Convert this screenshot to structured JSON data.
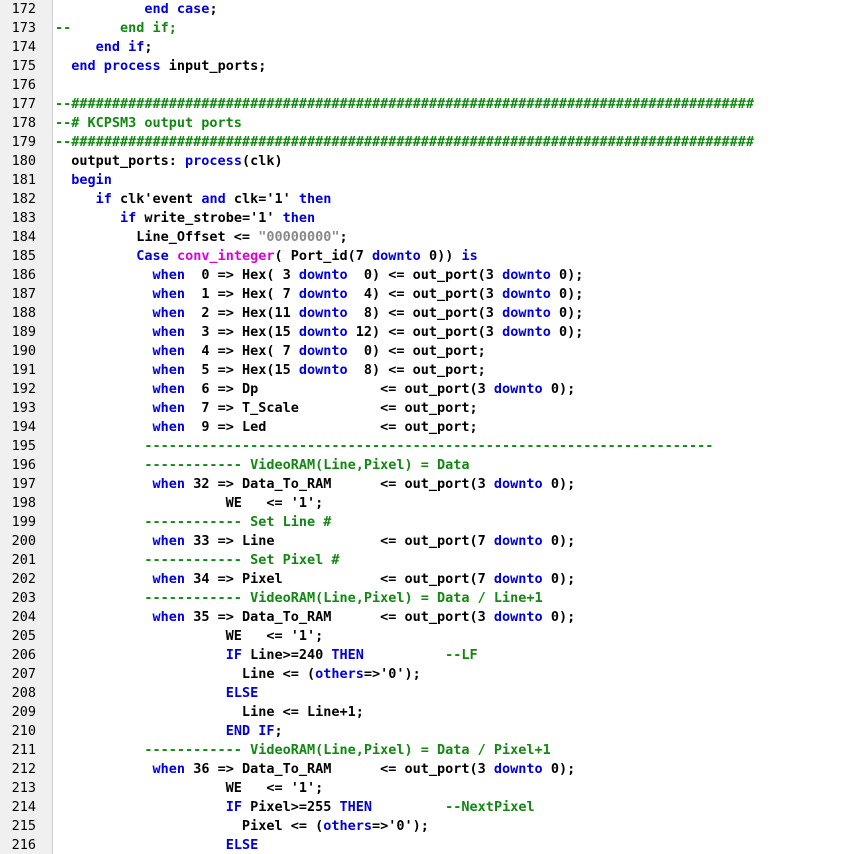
{
  "editor": {
    "language": "VHDL",
    "colors": {
      "keyword": "#0000dd",
      "comment": "#118811",
      "function": "#dd00dd",
      "string": "#888888",
      "text": "#000000",
      "gutter": "#f0f0f0"
    },
    "lines": [
      {
        "n": "172",
        "segs": [
          [
            "n",
            "           "
          ],
          [
            "k",
            "end case"
          ],
          [
            "n",
            ";"
          ]
        ]
      },
      {
        "n": "173",
        "segs": [
          [
            "c",
            "--      end if;"
          ]
        ]
      },
      {
        "n": "174",
        "segs": [
          [
            "n",
            "     "
          ],
          [
            "k",
            "end if"
          ],
          [
            "n",
            ";"
          ]
        ]
      },
      {
        "n": "175",
        "segs": [
          [
            "n",
            "  "
          ],
          [
            "k",
            "end process"
          ],
          [
            "n",
            " input_ports;"
          ]
        ]
      },
      {
        "n": "176",
        "segs": []
      },
      {
        "n": "177",
        "segs": [
          [
            "c",
            "--####################################################################################"
          ]
        ]
      },
      {
        "n": "178",
        "segs": [
          [
            "c",
            "--# KCPSM3 output ports"
          ]
        ]
      },
      {
        "n": "179",
        "segs": [
          [
            "c",
            "--####################################################################################"
          ]
        ]
      },
      {
        "n": "180",
        "segs": [
          [
            "n",
            "  output_ports: "
          ],
          [
            "k",
            "process"
          ],
          [
            "n",
            "(clk)"
          ]
        ]
      },
      {
        "n": "181",
        "segs": [
          [
            "n",
            "  "
          ],
          [
            "k",
            "begin"
          ]
        ]
      },
      {
        "n": "182",
        "segs": [
          [
            "n",
            "     "
          ],
          [
            "k",
            "if"
          ],
          [
            "n",
            " clk'event "
          ],
          [
            "k",
            "and"
          ],
          [
            "n",
            " clk='1' "
          ],
          [
            "k",
            "then"
          ]
        ]
      },
      {
        "n": "183",
        "segs": [
          [
            "n",
            "        "
          ],
          [
            "k",
            "if"
          ],
          [
            "n",
            " write_strobe='1' "
          ],
          [
            "k",
            "then"
          ]
        ]
      },
      {
        "n": "184",
        "segs": [
          [
            "n",
            "          Line_Offset <= "
          ],
          [
            "s",
            "\"00000000\""
          ],
          [
            "n",
            ";"
          ]
        ]
      },
      {
        "n": "185",
        "segs": [
          [
            "n",
            "          "
          ],
          [
            "k",
            "Case"
          ],
          [
            "n",
            " "
          ],
          [
            "f",
            "conv_integer"
          ],
          [
            "n",
            "( Port_id(7 "
          ],
          [
            "k",
            "downto"
          ],
          [
            "n",
            " 0)) "
          ],
          [
            "k",
            "is"
          ]
        ]
      },
      {
        "n": "186",
        "segs": [
          [
            "n",
            "            "
          ],
          [
            "k",
            "when"
          ],
          [
            "n",
            "  0 => Hex( 3 "
          ],
          [
            "k",
            "downto"
          ],
          [
            "n",
            "  0) <= out_port(3 "
          ],
          [
            "k",
            "downto"
          ],
          [
            "n",
            " 0);"
          ]
        ]
      },
      {
        "n": "187",
        "segs": [
          [
            "n",
            "            "
          ],
          [
            "k",
            "when"
          ],
          [
            "n",
            "  1 => Hex( 7 "
          ],
          [
            "k",
            "downto"
          ],
          [
            "n",
            "  4) <= out_port(3 "
          ],
          [
            "k",
            "downto"
          ],
          [
            "n",
            " 0);"
          ]
        ]
      },
      {
        "n": "188",
        "segs": [
          [
            "n",
            "            "
          ],
          [
            "k",
            "when"
          ],
          [
            "n",
            "  2 => Hex(11 "
          ],
          [
            "k",
            "downto"
          ],
          [
            "n",
            "  8) <= out_port(3 "
          ],
          [
            "k",
            "downto"
          ],
          [
            "n",
            " 0);"
          ]
        ]
      },
      {
        "n": "189",
        "segs": [
          [
            "n",
            "            "
          ],
          [
            "k",
            "when"
          ],
          [
            "n",
            "  3 => Hex(15 "
          ],
          [
            "k",
            "downto"
          ],
          [
            "n",
            " 12) <= out_port(3 "
          ],
          [
            "k",
            "downto"
          ],
          [
            "n",
            " 0);"
          ]
        ]
      },
      {
        "n": "190",
        "segs": [
          [
            "n",
            "            "
          ],
          [
            "k",
            "when"
          ],
          [
            "n",
            "  4 => Hex( 7 "
          ],
          [
            "k",
            "downto"
          ],
          [
            "n",
            "  0) <= out_port;"
          ]
        ]
      },
      {
        "n": "191",
        "segs": [
          [
            "n",
            "            "
          ],
          [
            "k",
            "when"
          ],
          [
            "n",
            "  5 => Hex(15 "
          ],
          [
            "k",
            "downto"
          ],
          [
            "n",
            "  8) <= out_port;"
          ]
        ]
      },
      {
        "n": "192",
        "segs": [
          [
            "n",
            "            "
          ],
          [
            "k",
            "when"
          ],
          [
            "n",
            "  6 => Dp               <= out_port(3 "
          ],
          [
            "k",
            "downto"
          ],
          [
            "n",
            " 0);"
          ]
        ]
      },
      {
        "n": "193",
        "segs": [
          [
            "n",
            "            "
          ],
          [
            "k",
            "when"
          ],
          [
            "n",
            "  7 => T_Scale          <= out_port;"
          ]
        ]
      },
      {
        "n": "194",
        "segs": [
          [
            "n",
            "            "
          ],
          [
            "k",
            "when"
          ],
          [
            "n",
            "  9 => Led              <= out_port;"
          ]
        ]
      },
      {
        "n": "195",
        "segs": [
          [
            "n",
            "           "
          ],
          [
            "c",
            "----------------------------------------------------------------------"
          ]
        ]
      },
      {
        "n": "196",
        "segs": [
          [
            "n",
            "           "
          ],
          [
            "c",
            "------------ VideoRAM(Line,Pixel) = Data"
          ]
        ]
      },
      {
        "n": "197",
        "segs": [
          [
            "n",
            "            "
          ],
          [
            "k",
            "when"
          ],
          [
            "n",
            " 32 => Data_To_RAM      <= out_port(3 "
          ],
          [
            "k",
            "downto"
          ],
          [
            "n",
            " 0);"
          ]
        ]
      },
      {
        "n": "198",
        "segs": [
          [
            "n",
            "                     WE   <= '1';"
          ]
        ]
      },
      {
        "n": "199",
        "segs": [
          [
            "n",
            "           "
          ],
          [
            "c",
            "------------ Set Line #"
          ]
        ]
      },
      {
        "n": "200",
        "segs": [
          [
            "n",
            "            "
          ],
          [
            "k",
            "when"
          ],
          [
            "n",
            " 33 => Line             <= out_port(7 "
          ],
          [
            "k",
            "downto"
          ],
          [
            "n",
            " 0);"
          ]
        ]
      },
      {
        "n": "201",
        "segs": [
          [
            "n",
            "           "
          ],
          [
            "c",
            "------------ Set Pixel #"
          ]
        ]
      },
      {
        "n": "202",
        "segs": [
          [
            "n",
            "            "
          ],
          [
            "k",
            "when"
          ],
          [
            "n",
            " 34 => Pixel            <= out_port(7 "
          ],
          [
            "k",
            "downto"
          ],
          [
            "n",
            " 0);"
          ]
        ]
      },
      {
        "n": "203",
        "segs": [
          [
            "n",
            "           "
          ],
          [
            "c",
            "------------ VideoRAM(Line,Pixel) = Data / Line+1"
          ]
        ]
      },
      {
        "n": "204",
        "segs": [
          [
            "n",
            "            "
          ],
          [
            "k",
            "when"
          ],
          [
            "n",
            " 35 => Data_To_RAM      <= out_port(3 "
          ],
          [
            "k",
            "downto"
          ],
          [
            "n",
            " 0);"
          ]
        ]
      },
      {
        "n": "205",
        "segs": [
          [
            "n",
            "                     WE   <= '1';"
          ]
        ]
      },
      {
        "n": "206",
        "segs": [
          [
            "n",
            "                     "
          ],
          [
            "k",
            "IF"
          ],
          [
            "n",
            " Line>=240 "
          ],
          [
            "k",
            "THEN"
          ],
          [
            "n",
            "          "
          ],
          [
            "c",
            "--LF"
          ]
        ]
      },
      {
        "n": "207",
        "segs": [
          [
            "n",
            "                       Line <= ("
          ],
          [
            "k",
            "others"
          ],
          [
            "n",
            "=>'0');"
          ]
        ]
      },
      {
        "n": "208",
        "segs": [
          [
            "n",
            "                     "
          ],
          [
            "k",
            "ELSE"
          ]
        ]
      },
      {
        "n": "209",
        "segs": [
          [
            "n",
            "                       Line <= Line+1;"
          ]
        ]
      },
      {
        "n": "210",
        "segs": [
          [
            "n",
            "                     "
          ],
          [
            "k",
            "END IF"
          ],
          [
            "n",
            ";"
          ]
        ]
      },
      {
        "n": "211",
        "segs": [
          [
            "n",
            "           "
          ],
          [
            "c",
            "------------ VideoRAM(Line,Pixel) = Data / Pixel+1"
          ]
        ]
      },
      {
        "n": "212",
        "segs": [
          [
            "n",
            "            "
          ],
          [
            "k",
            "when"
          ],
          [
            "n",
            " 36 => Data_To_RAM      <= out_port(3 "
          ],
          [
            "k",
            "downto"
          ],
          [
            "n",
            " 0);"
          ]
        ]
      },
      {
        "n": "213",
        "segs": [
          [
            "n",
            "                     WE   <= '1';"
          ]
        ]
      },
      {
        "n": "214",
        "segs": [
          [
            "n",
            "                     "
          ],
          [
            "k",
            "IF"
          ],
          [
            "n",
            " Pixel>=255 "
          ],
          [
            "k",
            "THEN"
          ],
          [
            "n",
            "         "
          ],
          [
            "c",
            "--NextPixel"
          ]
        ]
      },
      {
        "n": "215",
        "segs": [
          [
            "n",
            "                       Pixel <= ("
          ],
          [
            "k",
            "others"
          ],
          [
            "n",
            "=>'0');"
          ]
        ]
      },
      {
        "n": "216",
        "segs": [
          [
            "n",
            "                     "
          ],
          [
            "k",
            "ELSE"
          ]
        ]
      }
    ]
  }
}
